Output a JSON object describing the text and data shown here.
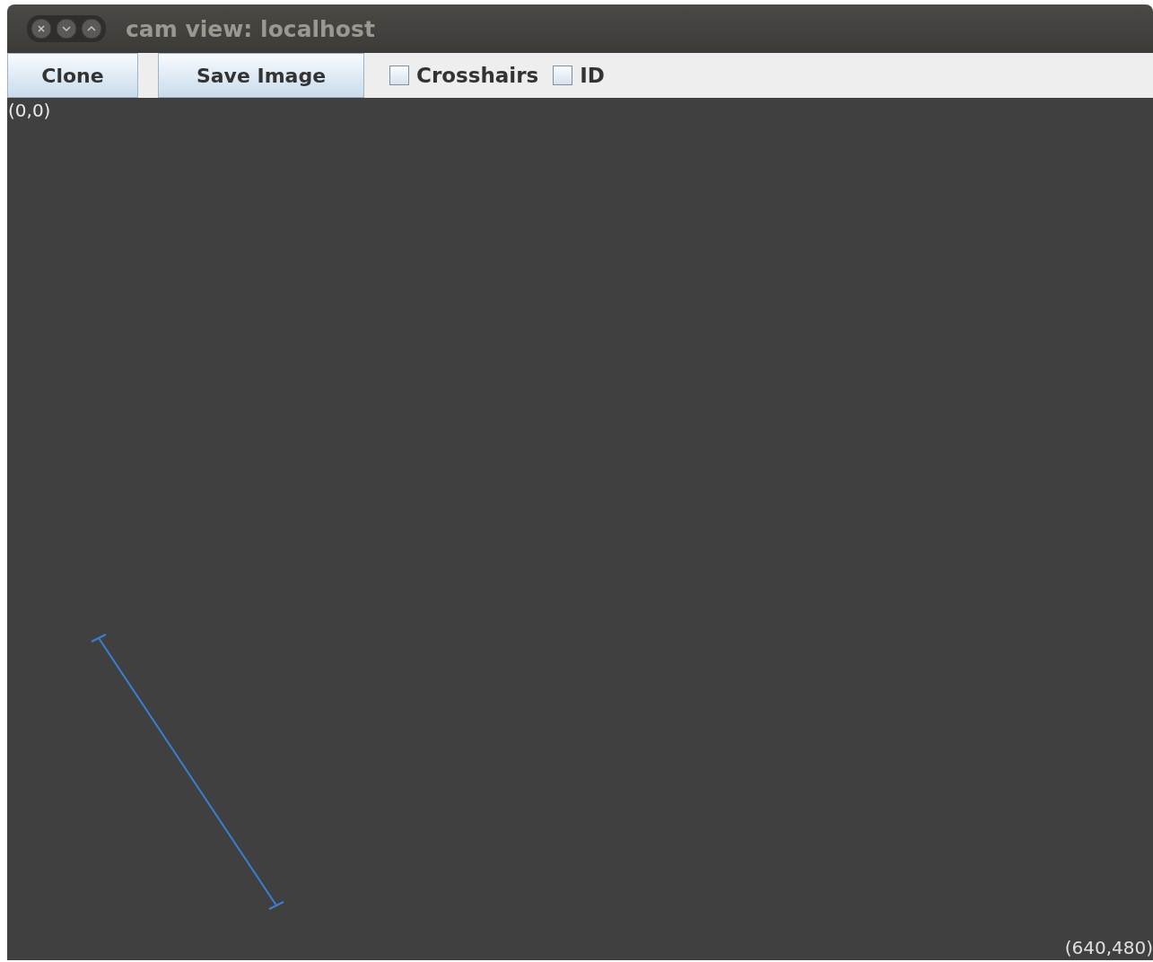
{
  "window": {
    "title": "cam view: localhost"
  },
  "toolbar": {
    "buttons": [
      "Clone",
      "Save Image"
    ],
    "checkboxes": [
      {
        "label": "Crosshairs",
        "checked": false
      },
      {
        "label": "ID",
        "checked": false
      }
    ]
  },
  "view": {
    "top_left_label": "(0,0)",
    "bottom_right_label": "(640,480)"
  }
}
